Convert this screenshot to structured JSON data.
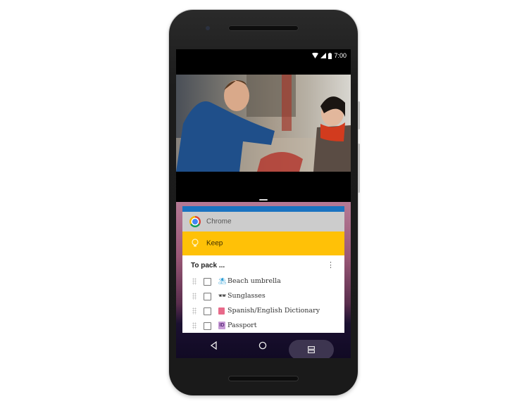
{
  "status_bar": {
    "time": "7:00",
    "icons": [
      "wifi-icon",
      "signal-icon",
      "battery-icon"
    ]
  },
  "top_app": {
    "type": "video",
    "description": "Man in blue jacket talking to woman with red scarf near bikes"
  },
  "recents": {
    "cards": [
      {
        "app": "Chrome",
        "icon": "chrome-icon",
        "header_color": "#cccccc",
        "accent": "#1a73c1"
      },
      {
        "app": "Keep",
        "icon": "lightbulb-icon",
        "header_color": "#ffc107"
      }
    ],
    "note": {
      "title": "To pack ...",
      "items": [
        {
          "emoji": "umbrella-icon",
          "glyph": "⛱",
          "label": "Beach umbrella",
          "checked": false
        },
        {
          "emoji": "sunglasses-icon",
          "glyph": "🕶",
          "label": "Sunglasses",
          "checked": false
        },
        {
          "emoji": "book-icon",
          "glyph": "📕",
          "label": "Spanish/English Dictionary",
          "checked": false
        },
        {
          "emoji": "id-icon",
          "glyph": "ID",
          "label": "Passport",
          "checked": false
        }
      ]
    }
  },
  "navbar": {
    "back": "back-icon",
    "home": "home-icon",
    "recents": "overview-icon"
  }
}
